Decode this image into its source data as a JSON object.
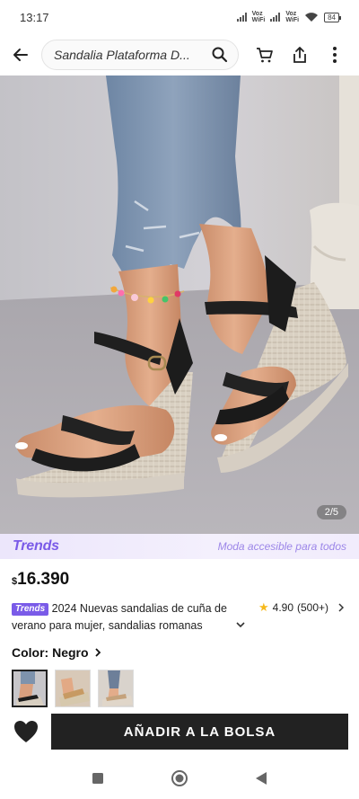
{
  "status_bar": {
    "time": "13:17",
    "network_1": "Voz WiFi",
    "network_2": "Voz WiFi",
    "battery": "84"
  },
  "header": {
    "search_text": "Sandalia Plataforma D...",
    "icons": [
      "back-arrow-icon",
      "search-icon",
      "cart-icon",
      "share-icon",
      "more-vert-icon"
    ]
  },
  "gallery": {
    "counter": "2/5"
  },
  "trends_banner": {
    "logo": "Trends",
    "tagline": "Moda accesible para todos",
    "accent_color": "#7a5be8"
  },
  "product": {
    "currency_symbol": "$",
    "price": "16.390",
    "badge": "Trends",
    "title": "2024 Nuevas sandalias de cuña de verano para mujer, sandalias romanas",
    "rating": "4.90",
    "reviews": "(500+)",
    "color_label": "Color:",
    "color_value": "Negro",
    "swatch_count": 3,
    "selected_swatch": 0
  },
  "actions": {
    "add_to_bag": "AÑADIR A LA BOLSA",
    "button_color": "#222222"
  },
  "nav": {
    "icons": [
      "recents-square-icon",
      "home-circle-icon",
      "back-triangle-icon"
    ]
  }
}
